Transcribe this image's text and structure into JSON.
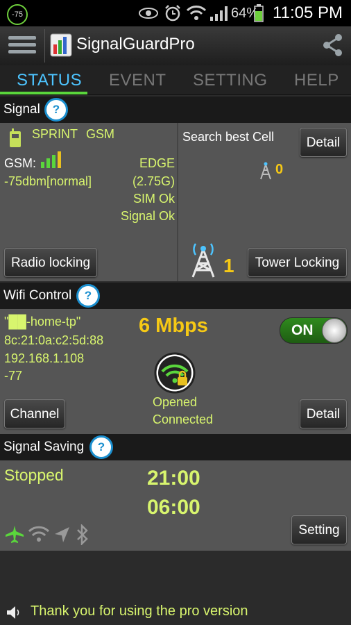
{
  "status_bar": {
    "badge": "-75",
    "battery": "64%",
    "time": "11:05 PM"
  },
  "app": {
    "title": "SignalGuardPro"
  },
  "tabs": [
    {
      "label": "STATUS",
      "active": true
    },
    {
      "label": "EVENT"
    },
    {
      "label": "SETTING"
    },
    {
      "label": "HELP"
    }
  ],
  "signal": {
    "header": "Signal",
    "carrier": "SPRINT",
    "network": "GSM",
    "gsm_label": "GSM:",
    "strength": "-75dbm[normal]",
    "data_type": "EDGE",
    "data_gen": "(2.75G)",
    "sim_status": "SIM Ok",
    "signal_status": "Signal Ok",
    "search_label": "Search best Cell",
    "detail_button": "Detail",
    "cell_count": "0",
    "radio_lock_button": "Radio locking",
    "tower_count": "1",
    "tower_lock_button": "Tower Locking"
  },
  "wifi": {
    "header": "Wifi Control",
    "ssid": "\"██-home-tp\"",
    "speed": "6 Mbps",
    "toggle": "ON",
    "mac": "8c:21:0a:c2:5d:88",
    "ip": "192.168.1.108",
    "rssi": "-77",
    "state1": "Opened",
    "state2": "Connected",
    "channel_button": "Channel",
    "detail_button": "Detail"
  },
  "saving": {
    "header": "Signal Saving",
    "status": "Stopped",
    "time_start": "21:00",
    "time_end": "06:00",
    "setting_button": "Setting"
  },
  "footer": {
    "message": "Thank you for using the pro version"
  },
  "colors": {
    "accent_blue": "#4dc4ff",
    "accent_green": "#5ad63c",
    "value_green": "#d8f56e",
    "value_yellow": "#f6c915"
  }
}
